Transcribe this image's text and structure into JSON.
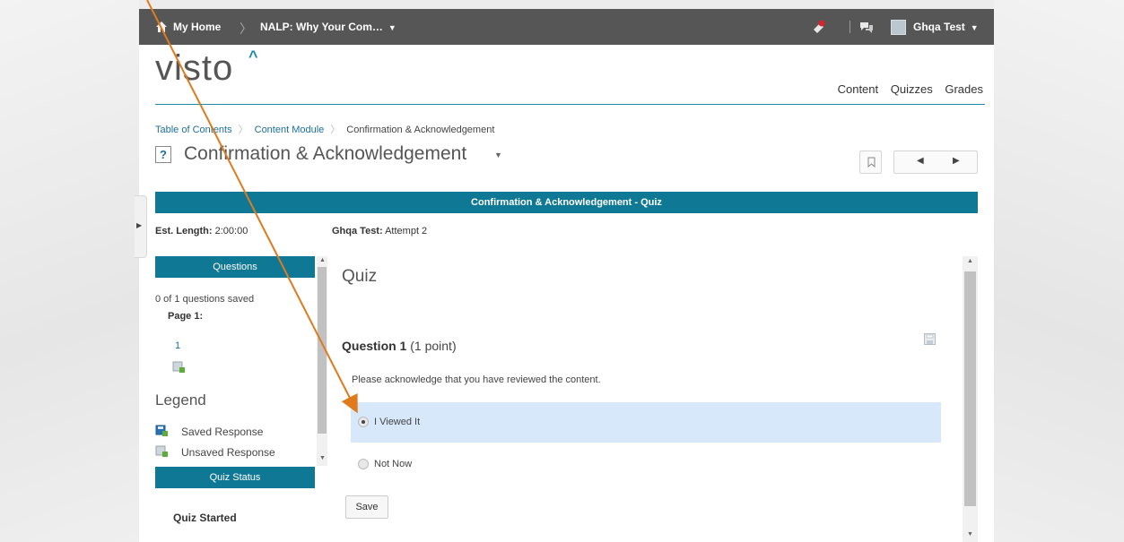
{
  "topbar": {
    "home_label": "My Home",
    "course_label": "NALP: Why Your Com…",
    "user_name": "Ghqa Test"
  },
  "brand": {
    "logo_text": "visto"
  },
  "top_nav": {
    "content": "Content",
    "quizzes": "Quizzes",
    "grades": "Grades"
  },
  "breadcrumb": {
    "items": [
      "Table of Contents",
      "Content Module",
      "Confirmation & Acknowledgement"
    ]
  },
  "page": {
    "title": "Confirmation & Acknowledgement"
  },
  "quiz_header": "Confirmation & Acknowledgement - Quiz",
  "meta": {
    "est_label": "Est. Length:",
    "est_value": "2:00:00",
    "user_label": "Ghqa Test:",
    "attempt": "Attempt 2"
  },
  "sidebar": {
    "questions_header": "Questions",
    "saved_count": "0 of 1 questions saved",
    "page_label": "Page 1:",
    "question_link": "1",
    "legend_title": "Legend",
    "legend_saved": "Saved Response",
    "legend_unsaved": "Unsaved Response",
    "status_header": "Quiz Status",
    "status_text": "Quiz Started"
  },
  "quiz": {
    "title": "Quiz",
    "question_label": "Question 1",
    "points": "(1 point)",
    "prompt": "Please acknowledge that you have reviewed the content.",
    "options": [
      "I Viewed It",
      "Not Now"
    ],
    "selected_option": "I Viewed It",
    "save_label": "Save"
  },
  "colors": {
    "accent": "#0f7895",
    "topbar": "#565656",
    "selected_row": "#d6e8fa",
    "annotation_arrow": "#e07a1c"
  }
}
